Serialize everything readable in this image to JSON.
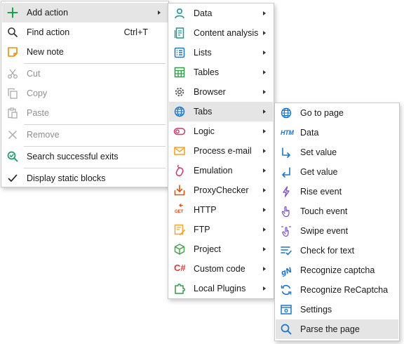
{
  "menu_main": {
    "add_action": "Add action",
    "find_action": "Find action",
    "find_action_shortcut": "Ctrl+T",
    "new_note": "New note",
    "cut": "Cut",
    "copy": "Copy",
    "paste": "Paste",
    "remove": "Remove",
    "search_successful_exits": "Search successful exits",
    "display_static_blocks": "Display static blocks"
  },
  "menu_actions": {
    "items": [
      {
        "label": "Data",
        "icon": "person-icon"
      },
      {
        "label": "Content analysis",
        "icon": "document-icon"
      },
      {
        "label": "Lists",
        "icon": "list-icon"
      },
      {
        "label": "Tables",
        "icon": "table-icon"
      },
      {
        "label": "Browser",
        "icon": "gear-icon"
      },
      {
        "label": "Tabs",
        "icon": "globe-icon"
      },
      {
        "label": "Logic",
        "icon": "toggle-icon"
      },
      {
        "label": "Process e-mail",
        "icon": "envelope-icon"
      },
      {
        "label": "Emulation",
        "icon": "mouse-icon"
      },
      {
        "label": "ProxyChecker",
        "icon": "download-box-icon"
      },
      {
        "label": "HTTP",
        "icon": "get-request-icon"
      },
      {
        "label": "FTP",
        "icon": "ftp-icon"
      },
      {
        "label": "Project",
        "icon": "cube-icon"
      },
      {
        "label": "Custom code",
        "icon": "csharp-icon"
      },
      {
        "label": "Local Plugins",
        "icon": "puzzle-icon"
      }
    ],
    "active_item": "Tabs"
  },
  "menu_tabs": {
    "items": [
      {
        "label": "Go to page",
        "icon": "globe-icon"
      },
      {
        "label": "Data",
        "icon": "htm-icon"
      },
      {
        "label": "Set value",
        "icon": "arrow-down-right-icon"
      },
      {
        "label": "Get value",
        "icon": "arrow-down-left-icon"
      },
      {
        "label": "Rise event",
        "icon": "lightning-icon"
      },
      {
        "label": "Touch event",
        "icon": "touch-icon"
      },
      {
        "label": "Swipe event",
        "icon": "swipe-icon"
      },
      {
        "label": "Check for text",
        "icon": "check-text-icon"
      },
      {
        "label": "Recognize captcha",
        "icon": "captcha-icon"
      },
      {
        "label": "Recognize ReCaptcha",
        "icon": "recaptcha-icon"
      },
      {
        "label": "Settings",
        "icon": "settings-window-icon"
      },
      {
        "label": "Parse the page",
        "icon": "search-icon"
      }
    ],
    "active_item": "Parse the page"
  },
  "colors": {
    "green": "#16a34a",
    "teal": "#1a9c8f",
    "blue": "#1976d2",
    "orange": "#f5a623",
    "red": "#e53935",
    "pink": "#d6336c",
    "purple": "#7e57c2",
    "highlight": "#e5e5e5",
    "disabled_text": "#8f8f8f"
  }
}
